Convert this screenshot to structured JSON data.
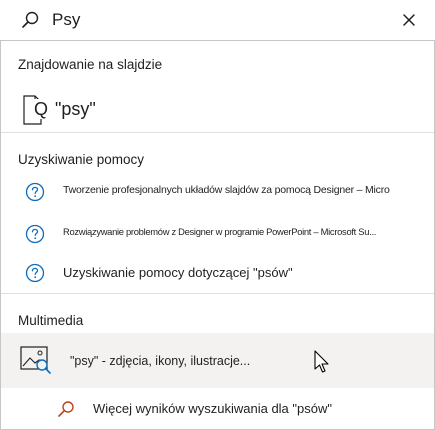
{
  "search": {
    "value": "Psy",
    "icon": "search-icon",
    "clear_icon": "close-icon"
  },
  "sections": {
    "find": {
      "title": "Znajdowanie na slajdzie",
      "result": "\"psy\"",
      "icon": "find-in-slide-icon"
    },
    "help": {
      "title": "Uzyskiwanie pomocy",
      "items": [
        {
          "label": "Tworzenie profesjonalnych układów slajdów za pomocą Designer – Micro",
          "icon": "help-circle-icon"
        },
        {
          "label": "Rozwiązywanie problemów z Designer w programie PowerPoint – Microsoft Su...",
          "icon": "help-circle-icon"
        },
        {
          "label": "Uzyskiwanie pomocy dotyczącej \"psów\"",
          "icon": "help-circle-icon"
        }
      ]
    },
    "media": {
      "title": "Multimedia",
      "item": "\"psy\" - zdjęcia, ikony, ilustracje...",
      "icon": "image-search-icon"
    },
    "more": {
      "label": "Więcej wyników wyszukiwania dla \"psów\"",
      "icon": "search-icon"
    }
  },
  "colors": {
    "accent": "#0f6cbd",
    "more_search_icon": "#c43e1c",
    "hover_bg": "#f3f2f1",
    "divider": "#e1dfdd"
  }
}
